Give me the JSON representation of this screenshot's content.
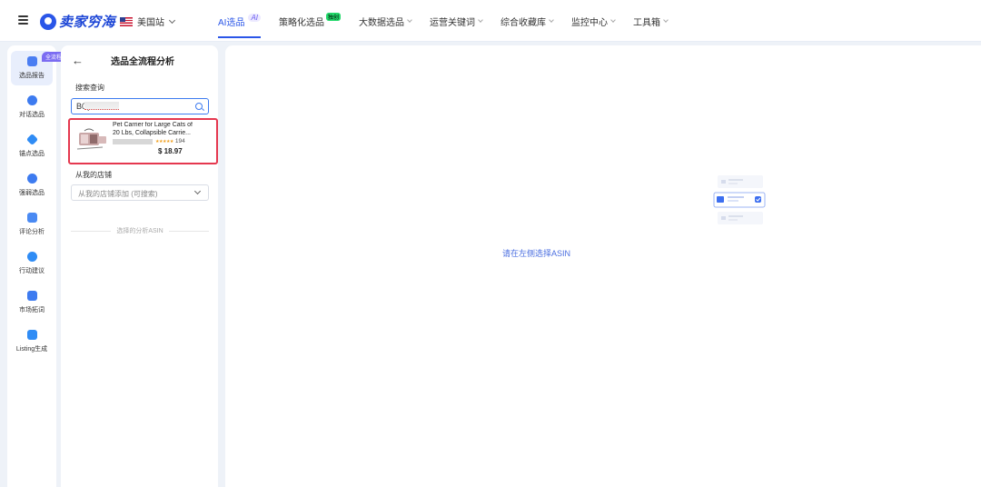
{
  "header": {
    "logo_text": "卖家穷海",
    "site": "美国站",
    "nav": [
      {
        "label": "AI选品",
        "badge": "AI"
      },
      {
        "label": "策略化选品",
        "badge": "独创"
      },
      {
        "label": "大数据选品"
      },
      {
        "label": "运营关键词"
      },
      {
        "label": "综合收藏库"
      },
      {
        "label": "监控中心"
      },
      {
        "label": "工具箱"
      }
    ]
  },
  "sidebar": {
    "full_badge": "全流程",
    "items": [
      {
        "label": "选品报告",
        "icon": "report-icon"
      },
      {
        "label": "对话选品",
        "icon": "chat-icon"
      },
      {
        "label": "锚点选品",
        "icon": "anchor-icon"
      },
      {
        "label": "强弱选品",
        "icon": "user-icon"
      },
      {
        "label": "评论分析",
        "icon": "comment-icon"
      },
      {
        "label": "行动建议",
        "icon": "compass-icon"
      },
      {
        "label": "市场拓词",
        "icon": "keyword-icon"
      },
      {
        "label": "Listing生成",
        "icon": "listing-icon"
      }
    ]
  },
  "panel": {
    "title": "选品全流程分析",
    "search_section": "搜索查询",
    "search_value": "B0(",
    "product": {
      "title": "Pet Carrier for Large Cats of 20 Lbs, Collapsible Carrie...",
      "rating_count": "194",
      "price": "$ 18.97"
    },
    "store_section": "从我的店铺",
    "store_placeholder": "从我的店铺添加 (可搜索)",
    "divider_text": "选择的分析ASIN"
  },
  "main": {
    "empty_text": "请在左侧选择ASIN"
  },
  "colors": {
    "accent": "#2a56e8",
    "highlight_border": "#e5384f"
  }
}
